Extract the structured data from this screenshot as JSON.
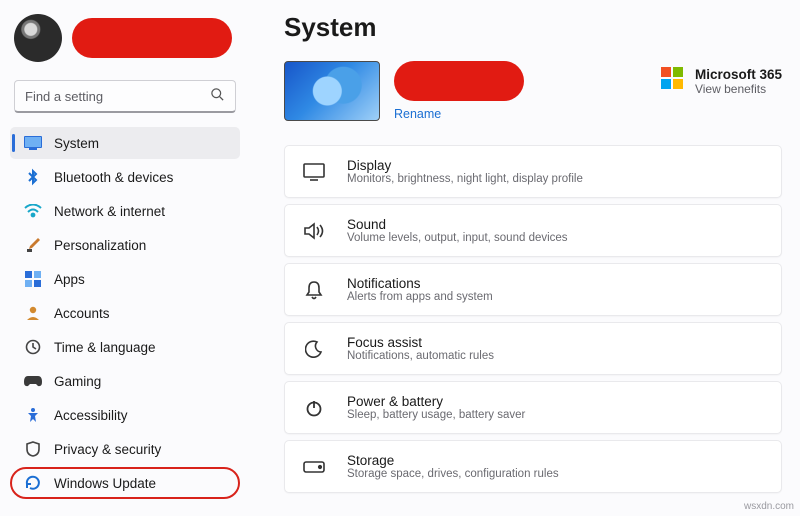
{
  "search": {
    "placeholder": "Find a setting"
  },
  "sidebar": {
    "items": [
      {
        "label": "System",
        "icon": "system"
      },
      {
        "label": "Bluetooth & devices",
        "icon": "bluetooth"
      },
      {
        "label": "Network & internet",
        "icon": "wifi"
      },
      {
        "label": "Personalization",
        "icon": "brush"
      },
      {
        "label": "Apps",
        "icon": "apps"
      },
      {
        "label": "Accounts",
        "icon": "account"
      },
      {
        "label": "Time & language",
        "icon": "clock"
      },
      {
        "label": "Gaming",
        "icon": "gaming"
      },
      {
        "label": "Accessibility",
        "icon": "accessibility"
      },
      {
        "label": "Privacy & security",
        "icon": "shield"
      },
      {
        "label": "Windows Update",
        "icon": "update"
      }
    ]
  },
  "page": {
    "title": "System"
  },
  "device": {
    "rename_label": "Rename"
  },
  "m365": {
    "title": "Microsoft 365",
    "subtitle": "View benefits"
  },
  "cards": [
    {
      "title": "Display",
      "subtitle": "Monitors, brightness, night light, display profile"
    },
    {
      "title": "Sound",
      "subtitle": "Volume levels, output, input, sound devices"
    },
    {
      "title": "Notifications",
      "subtitle": "Alerts from apps and system"
    },
    {
      "title": "Focus assist",
      "subtitle": "Notifications, automatic rules"
    },
    {
      "title": "Power & battery",
      "subtitle": "Sleep, battery usage, battery saver"
    },
    {
      "title": "Storage",
      "subtitle": "Storage space, drives, configuration rules"
    }
  ],
  "watermark": "wsxdn.com"
}
